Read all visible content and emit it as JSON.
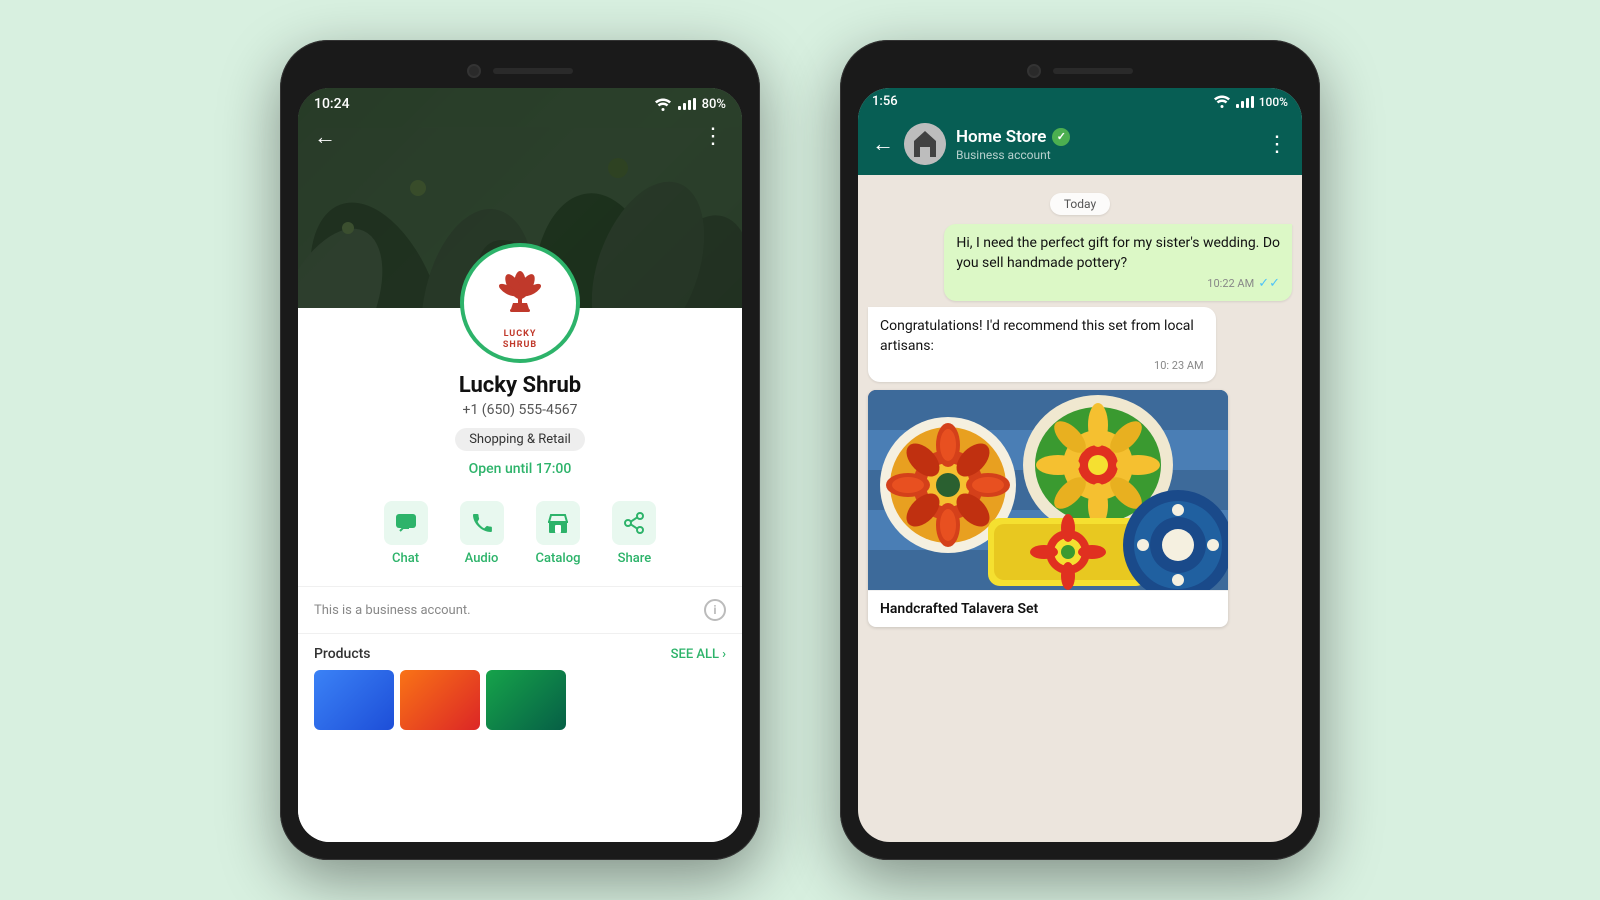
{
  "background_color": "#d8f0e0",
  "phone_left": {
    "status_bar": {
      "time": "10:24",
      "battery": "80%"
    },
    "profile": {
      "name": "Lucky Shrub",
      "phone": "+1 (650) 555-4567",
      "category": "Shopping & Retail",
      "hours": "Open until 17:00",
      "actions": [
        {
          "id": "chat",
          "label": "Chat",
          "icon": "chat"
        },
        {
          "id": "audio",
          "label": "Audio",
          "icon": "phone"
        },
        {
          "id": "catalog",
          "label": "Catalog",
          "icon": "store"
        },
        {
          "id": "share",
          "label": "Share",
          "icon": "share"
        }
      ],
      "notice": "This is a business account.",
      "products_label": "Products",
      "see_all": "SEE ALL"
    }
  },
  "phone_right": {
    "status_bar": {
      "time": "1:56",
      "battery": "100%"
    },
    "chat": {
      "contact_name": "Home Store",
      "contact_sub": "Business account",
      "verified": true,
      "date_divider": "Today",
      "messages": [
        {
          "type": "sent",
          "text": "Hi, I need the perfect gift for my sister's wedding. Do you sell handmade pottery?",
          "time": "10:22 AM",
          "ticks": "✓✓"
        },
        {
          "type": "received",
          "text": "Congratulations! I'd recommend this set from local artisans:",
          "time": "10: 23 AM"
        }
      ],
      "product_card": {
        "label": "Handcrafted Talavera Set"
      }
    }
  }
}
